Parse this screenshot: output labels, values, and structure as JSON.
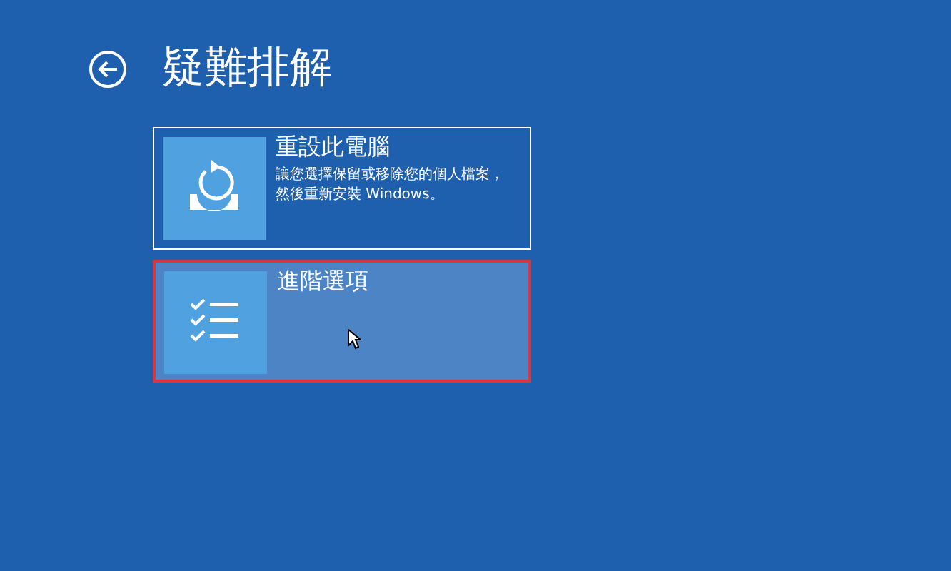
{
  "header": {
    "title": "疑難排解"
  },
  "options": [
    {
      "kind": "reset",
      "title": "重設此電腦",
      "description_lines": [
        "讓您選擇保留或移除您的個人檔案，",
        "然後重新安裝 Windows。"
      ],
      "focused": true,
      "hovered": false
    },
    {
      "kind": "advanced",
      "title": "進階選項",
      "focused": false,
      "hovered": true
    }
  ]
}
